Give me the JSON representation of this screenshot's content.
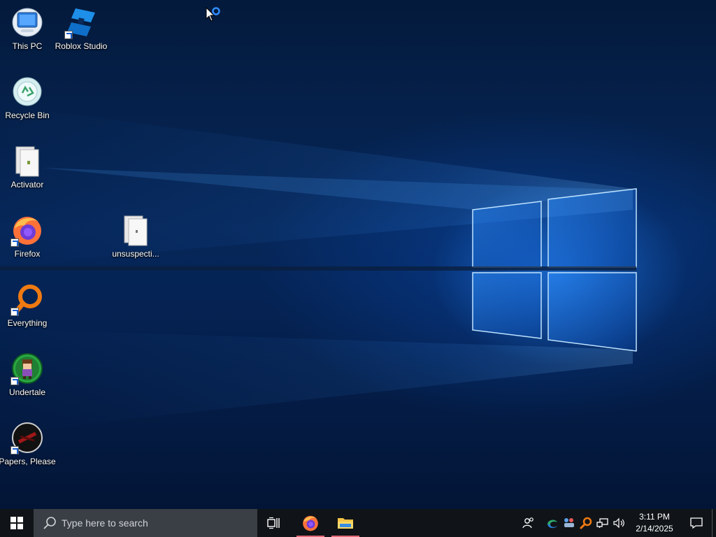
{
  "desktop": {
    "icons": [
      {
        "label": "This PC",
        "icon": "this-pc-icon",
        "shortcut": false
      },
      {
        "label": "Roblox Studio",
        "icon": "roblox-studio-icon",
        "shortcut": true
      },
      {
        "label": "Recycle Bin",
        "icon": "recycle-bin-icon",
        "shortcut": false
      },
      {
        "label": "Activator",
        "icon": "file-icon",
        "shortcut": false
      },
      {
        "label": "Firefox",
        "icon": "firefox-icon",
        "shortcut": true
      },
      {
        "label": "unsuspecti...",
        "icon": "file-icon",
        "shortcut": false
      },
      {
        "label": "Everything",
        "icon": "everything-search-icon",
        "shortcut": true
      },
      {
        "label": "Undertale",
        "icon": "undertale-icon",
        "shortcut": true
      },
      {
        "label": "Papers, Please",
        "icon": "papers-please-icon",
        "shortcut": true
      }
    ]
  },
  "taskbar": {
    "search_placeholder": "Type here to search",
    "pinned": [
      {
        "name": "task-view",
        "icon": "task-view-icon"
      },
      {
        "name": "firefox",
        "icon": "firefox-icon",
        "active": true
      },
      {
        "name": "file-explorer",
        "icon": "folder-icon",
        "active": true
      }
    ],
    "tray_icons": [
      "people-icon",
      "edge-update-icon",
      "network-users-icon",
      "everything-search-icon",
      "network-icon",
      "volume-icon"
    ],
    "clock": {
      "time": "3:11 PM",
      "date": "2/14/2025"
    },
    "colors": {
      "taskbar": "#101418",
      "search": "#3a3f45",
      "active_indicator": "#e46a78",
      "accent": "#1a78e6"
    }
  }
}
